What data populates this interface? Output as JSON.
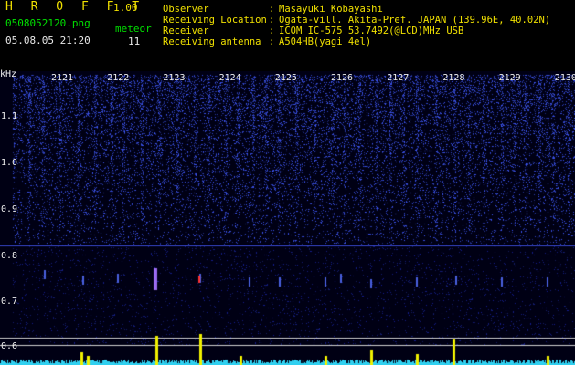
{
  "header": {
    "app_title": "H R O F F T",
    "app_version": "1.00",
    "file_name": "0508052120.png",
    "meteor_label": "meteor",
    "date_time": "05.08.05 21:20",
    "meteor_count": "11"
  },
  "info": [
    {
      "label": "Observer",
      "sep": ":",
      "value": "Masayuki Kobayashi"
    },
    {
      "label": "Receiving Location",
      "sep": ":",
      "value": "Ogata-vill. Akita-Pref. JAPAN (139.96E, 40.02N)"
    },
    {
      "label": "Receiver",
      "sep": ":",
      "value": "ICOM IC-575 53.7492(@LCD)MHz USB"
    },
    {
      "label": "Receiving antenna",
      "sep": ":",
      "value": "A504HB(yagi 4el)"
    }
  ],
  "spectrogram": {
    "unit_label": "kHz",
    "time_labels": [
      "2121",
      "2122",
      "2123",
      "2124",
      "2125",
      "2126",
      "2127",
      "2128",
      "2129",
      "2130"
    ],
    "freq_labels": [
      "1.1",
      "1.0",
      "0.9",
      "0.8",
      "0.7",
      "0.6"
    ],
    "colors": {
      "background": "#000014",
      "noise": "#2838c8",
      "signal_line": "#3848d0",
      "echo": "#ff3030",
      "meter": "#f0f000",
      "baseline": "#30d0f0"
    }
  }
}
